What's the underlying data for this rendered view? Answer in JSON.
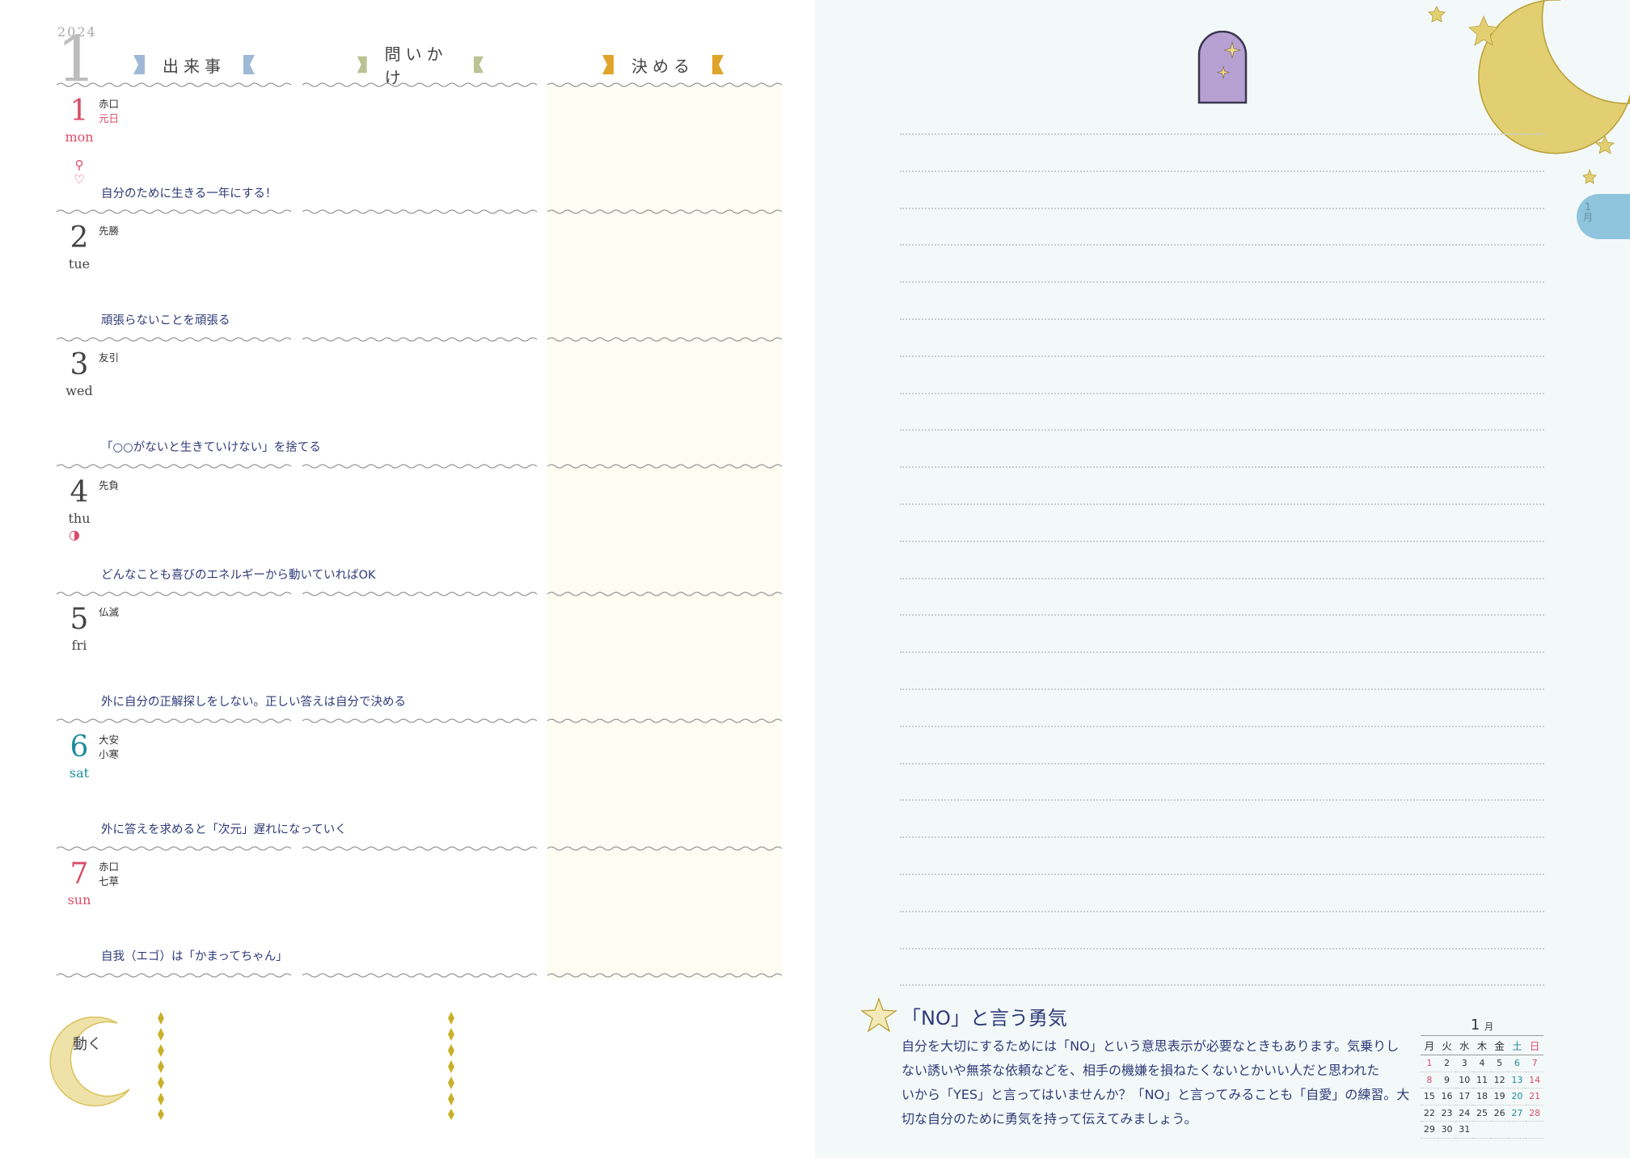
{
  "planner": {
    "year": "2024",
    "month": "1",
    "columns": {
      "events": "出来事",
      "questions": "問いかけ",
      "decide": "決める"
    },
    "days": [
      {
        "num": "1",
        "dow": "mon",
        "rokuyo": "赤口",
        "holiday": "元日",
        "motto": "自分のために生きる一年にする！",
        "color": "#d94c68",
        "extra": ""
      },
      {
        "num": "2",
        "dow": "tue",
        "rokuyo": "先勝",
        "holiday": "",
        "motto": "頑張らないことを頑張る",
        "color": "#444444",
        "extra": ""
      },
      {
        "num": "3",
        "dow": "wed",
        "rokuyo": "友引",
        "holiday": "",
        "motto": "「○○がないと生きていけない」を捨てる",
        "color": "#444444",
        "extra": ""
      },
      {
        "num": "4",
        "dow": "thu",
        "rokuyo": "先負",
        "holiday": "",
        "motto": "どんなことも喜びのエネルギーから動いていればOK",
        "color": "#444444",
        "extra": "◑"
      },
      {
        "num": "5",
        "dow": "fri",
        "rokuyo": "仏滅",
        "holiday": "",
        "motto": "外に自分の正解探しをしない。正しい答えは自分で決める",
        "color": "#444444",
        "extra": ""
      },
      {
        "num": "6",
        "dow": "sat",
        "rokuyo": "大安",
        "holiday": "",
        "rokuyo2": "小寒",
        "motto": "外に答えを求めると「次元」遅れになっていく",
        "color": "#1e8b9c",
        "extra": ""
      },
      {
        "num": "7",
        "dow": "sun",
        "rokuyo": "赤口",
        "holiday": "",
        "rokuyo2": "七草",
        "motto": "自我（エゴ）は「かまってちゃん」",
        "color": "#d94c68",
        "extra": ""
      }
    ],
    "bottom_label": "動く",
    "tab_label": "1月"
  },
  "column": {
    "title": "「NO」と言う勇気",
    "lines": [
      "自分を大切にするためには「NO」という意思表示が必要なときもあります。気乗りし",
      "ない誘いや無茶な依頼などを、相手の機嫌を損ねたくないとかいい人だと思われた",
      "いから「YES」と言ってはいませんか？「NO」と言ってみることも「自愛」の練習。大",
      "切な自分のために勇気を持って伝えてみましょう。"
    ]
  },
  "mini_calendar": {
    "month": "1",
    "month_unit": "月",
    "weekdays": [
      "月",
      "火",
      "水",
      "木",
      "金",
      "土",
      "日"
    ],
    "weeks": [
      [
        "1",
        "2",
        "3",
        "4",
        "5",
        "6",
        "7"
      ],
      [
        "8",
        "9",
        "10",
        "11",
        "12",
        "13",
        "14"
      ],
      [
        "15",
        "16",
        "17",
        "18",
        "19",
        "20",
        "21"
      ],
      [
        "22",
        "23",
        "24",
        "25",
        "26",
        "27",
        "28"
      ],
      [
        "29",
        "30",
        "31",
        "",
        "",
        "",
        ""
      ]
    ],
    "holidays": [
      "1",
      "8"
    ],
    "sat_color": "#1e8b9c",
    "sun_color": "#d94c68"
  },
  "colors": {
    "navy": "#2f3a78",
    "flag_blue": "#9fb8d6",
    "flag_green": "#b9c394",
    "flag_gold": "#e1a42a",
    "gold": "#d9c15a",
    "tab": "#8ec4dc",
    "arch": "#b7a1d2"
  }
}
